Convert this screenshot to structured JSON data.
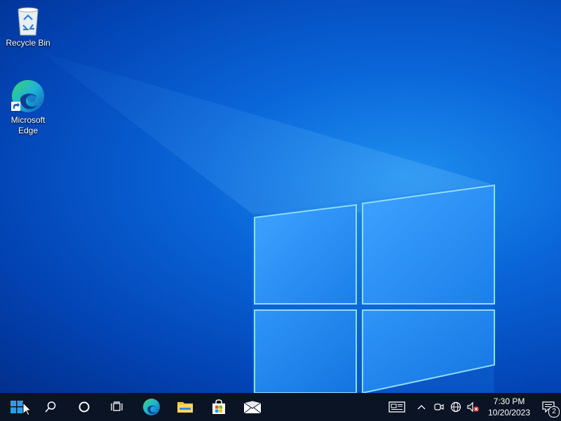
{
  "desktop": {
    "icons": [
      {
        "label": "Recycle Bin",
        "icon": "recycle-bin-icon"
      },
      {
        "label": "Microsoft\nEdge",
        "icon": "edge-icon",
        "shortcut": true
      }
    ]
  },
  "taskbar": {
    "start": {
      "icon": "windows-logo-icon"
    },
    "buttons": [
      {
        "name": "search",
        "icon": "search-icon"
      },
      {
        "name": "cortana",
        "icon": "cortana-circle-icon"
      },
      {
        "name": "task-view",
        "icon": "task-view-icon"
      },
      {
        "name": "edge",
        "icon": "edge-icon"
      },
      {
        "name": "file-explorer",
        "icon": "folder-icon"
      },
      {
        "name": "microsoft-store",
        "icon": "store-bag-icon"
      },
      {
        "name": "mail",
        "icon": "mail-icon"
      }
    ],
    "tray": {
      "icons": [
        "news-icon",
        "chevron-up-icon",
        "meet-now-icon",
        "network-icon",
        "volume-muted-icon"
      ],
      "time": "7:30 PM",
      "date": "10/20/2023",
      "notification_count": "2"
    }
  },
  "colors": {
    "taskbar": "#0b1424",
    "desktop_accent": "#0a66d8"
  }
}
